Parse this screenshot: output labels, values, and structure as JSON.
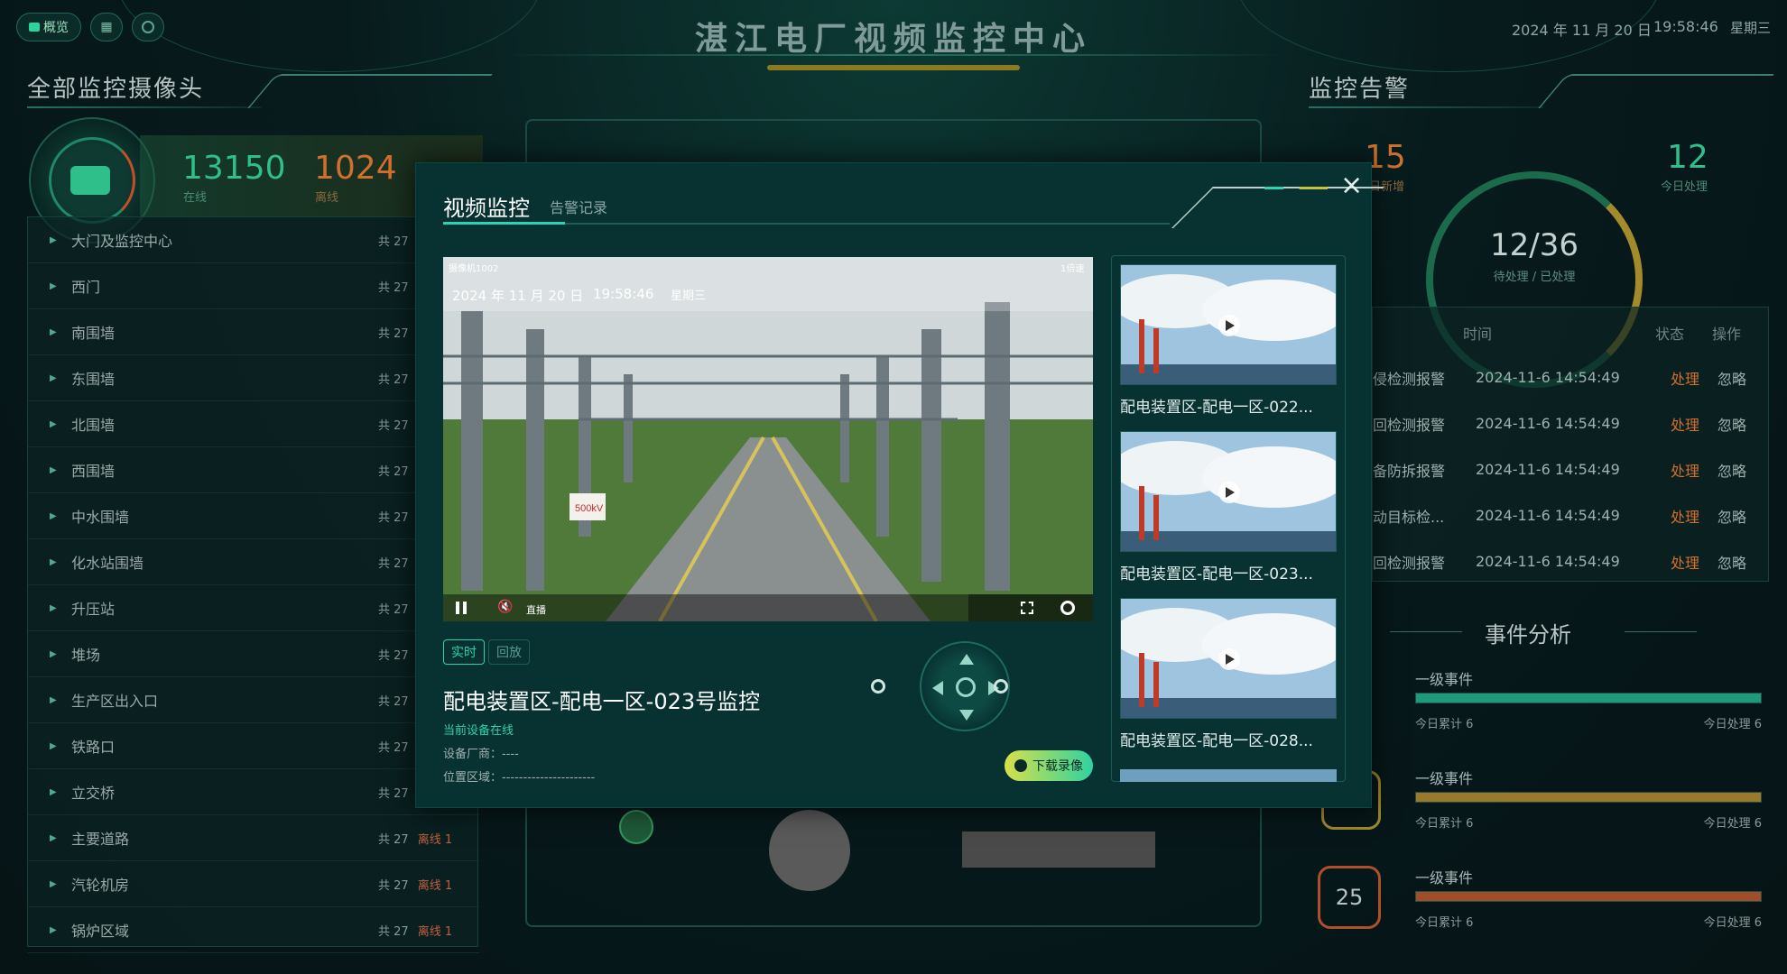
{
  "header": {
    "title": "湛江电厂视频监控中心",
    "overview_label": "概览",
    "date": "2024 年 11 月 20 日",
    "time": "19:58:46",
    "weekday": "星期三"
  },
  "left": {
    "title": "全部监控摄像头",
    "online_count": "13150",
    "online_label": "在线",
    "offline_count": "1024",
    "offline_label": "离线",
    "items": [
      {
        "name": "大门及监控中心",
        "count": "共 27",
        "offline": ""
      },
      {
        "name": "西门",
        "count": "共 27",
        "offline": ""
      },
      {
        "name": "南围墙",
        "count": "共 27",
        "offline": ""
      },
      {
        "name": "东围墙",
        "count": "共 27",
        "offline": ""
      },
      {
        "name": "北围墙",
        "count": "共 27",
        "offline": ""
      },
      {
        "name": "西围墙",
        "count": "共 27",
        "offline": ""
      },
      {
        "name": "中水围墙",
        "count": "共 27",
        "offline": ""
      },
      {
        "name": "化水站围墙",
        "count": "共 27",
        "offline": ""
      },
      {
        "name": "升压站",
        "count": "共 27",
        "offline": ""
      },
      {
        "name": "堆场",
        "count": "共 27",
        "offline": ""
      },
      {
        "name": "生产区出入口",
        "count": "共 27",
        "offline": ""
      },
      {
        "name": "铁路口",
        "count": "共 27",
        "offline": ""
      },
      {
        "name": "立交桥",
        "count": "共 27",
        "offline": ""
      },
      {
        "name": "主要道路",
        "count": "共 27",
        "offline": "离线 1"
      },
      {
        "name": "汽轮机房",
        "count": "共 27",
        "offline": "离线 1"
      },
      {
        "name": "锅炉区域",
        "count": "共 27",
        "offline": "离线 1"
      }
    ]
  },
  "right": {
    "title": "监控告警",
    "new_today": "15",
    "new_today_label": "日新增",
    "handled_today": "12",
    "handled_today_label": "今日处理",
    "gauge_value": "12/36",
    "gauge_label": "待处理 / 已处理",
    "col_time": "时间",
    "col_status": "状态",
    "col_action": "操作",
    "alarms": [
      {
        "type": "侵检测报警",
        "time": "2024-11-6 14:54:49",
        "status": "处理",
        "action": "忽略"
      },
      {
        "type": "回检测报警",
        "time": "2024-11-6 14:54:49",
        "status": "处理",
        "action": "忽略"
      },
      {
        "type": "备防拆报警",
        "time": "2024-11-6 14:54:49",
        "status": "处理",
        "action": "忽略"
      },
      {
        "type": "动目标检...",
        "time": "2024-11-6 14:54:49",
        "status": "处理",
        "action": "忽略"
      },
      {
        "type": "回检测报警",
        "time": "2024-11-6 14:54:49",
        "status": "处理",
        "action": "忽略"
      }
    ],
    "event_title": "事件分析",
    "events": [
      {
        "name": "一级事件",
        "total_label": "今日累计",
        "total": "6",
        "handled_label": "今日处理",
        "handled": "6",
        "color": "#1d9a7a"
      },
      {
        "name": "一级事件",
        "total_label": "今日累计",
        "total": "6",
        "handled_label": "今日处理",
        "handled": "6",
        "color": "#9a7a2a"
      },
      {
        "name": "一级事件",
        "total_label": "今日累计",
        "total": "6",
        "handled_label": "今日处理",
        "handled": "6",
        "color": "#a04e2a"
      }
    ],
    "hex_value": "25"
  },
  "modal": {
    "tab_active": "视频监控",
    "tab_inactive": "告警记录",
    "video": {
      "camera_id": "摄像机1002",
      "speed": "1倍速",
      "date": "2024 年 11 月 20 日",
      "time": "19:58:46",
      "weekday": "星期三",
      "live_label": "直播",
      "sign_text": "500kV"
    },
    "mode_live": "实时",
    "mode_playback": "回放",
    "camera_name": "配电装置区-配电一区-023号监控",
    "status_text": "当前设备在线",
    "vendor_label": "设备厂商：----",
    "location_label": "位置区域：----------------------",
    "download_label": "下载录像",
    "thumbs": [
      {
        "label": "配电装置区-配电一区-022..."
      },
      {
        "label": "配电装置区-配电一区-023..."
      },
      {
        "label": "配电装置区-配电一区-028..."
      }
    ]
  }
}
